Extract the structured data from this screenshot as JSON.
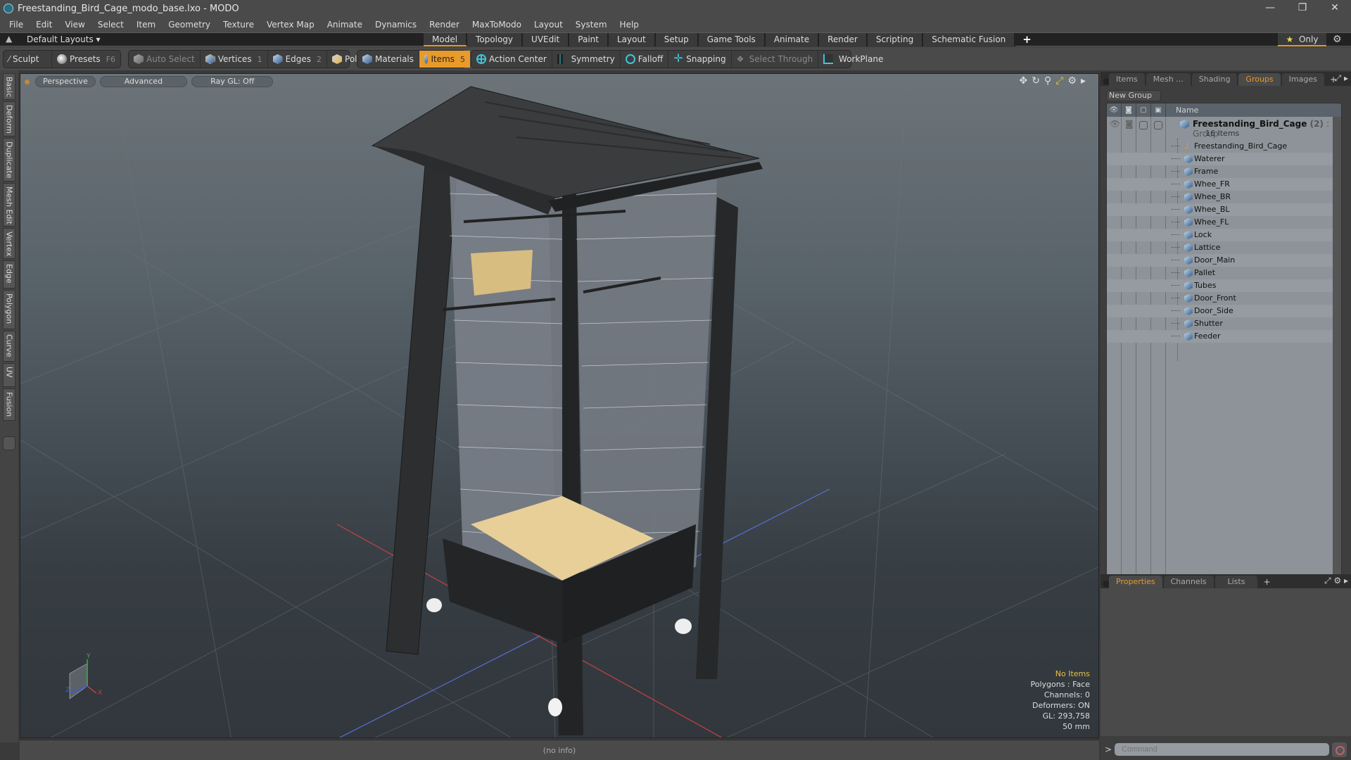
{
  "window": {
    "title": "Freestanding_Bird_Cage_modo_base.lxo - MODO",
    "controls": [
      "—",
      "❐",
      "✕"
    ]
  },
  "menu": [
    "File",
    "Edit",
    "View",
    "Select",
    "Item",
    "Geometry",
    "Texture",
    "Vertex Map",
    "Animate",
    "Dynamics",
    "Render",
    "MaxToModo",
    "Layout",
    "System",
    "Help"
  ],
  "layoutbar": {
    "layouts_label": "Default Layouts ▾",
    "tabs": [
      "Model",
      "Topology",
      "UVEdit",
      "Paint",
      "Layout",
      "Setup",
      "Game Tools",
      "Animate",
      "Render",
      "Scripting",
      "Schematic Fusion"
    ],
    "active_tab": "Model",
    "add": "+",
    "only_label": "Only",
    "accent": "#e59a2a"
  },
  "toolbar": {
    "sculpt": "Sculpt",
    "presets": "Presets",
    "presets_key": "F6",
    "auto_select": "Auto Select",
    "vertices": "Vertices",
    "vertices_key": "1",
    "edges": "Edges",
    "edges_key": "2",
    "polygons": "Polygons",
    "materials": "Materials",
    "items": "Items",
    "items_key": "5",
    "action_center": "Action Center",
    "symmetry": "Symmetry",
    "falloff": "Falloff",
    "snapping": "Snapping",
    "select_through": "Select Through",
    "workplane": "WorkPlane"
  },
  "left_tabs": [
    "Basic",
    "Deform",
    "Duplicate",
    "Mesh Edit",
    "Vertex",
    "Edge",
    "Polygon",
    "Curve",
    "UV",
    "Fusion"
  ],
  "viewport": {
    "view": "Perspective",
    "shading": "Advanced",
    "raygl": "Ray GL: Off",
    "info": {
      "selection": "No Items",
      "polygons": "Polygons : Face",
      "channels": "Channels: 0",
      "deformers": "Deformers: ON",
      "gl": "GL: 293,758",
      "scale": "50 mm"
    },
    "axis_labels": {
      "x": "X",
      "y": "Y",
      "z": "Z"
    }
  },
  "status": {
    "info": "(no info)"
  },
  "right_panel": {
    "tabs": [
      "Items",
      "Mesh ...",
      "Shading",
      "Groups",
      "Images"
    ],
    "active_tab": "Groups",
    "new_group": "New Group",
    "column_name": "Name",
    "group": {
      "name": "Freestanding_Bird_Cage",
      "count": "(2)",
      "type": ": Group",
      "items_label": "16 Items"
    },
    "members": [
      "Freestanding_Bird_Cage",
      "Waterer",
      "Frame",
      "Whee_FR",
      "Whee_BR",
      "Whee_BL",
      "Whee_FL",
      "Lock",
      "Lattice",
      "Door_Main",
      "Pallet",
      "Tubes",
      "Door_Front",
      "Door_Side",
      "Shutter",
      "Feeder"
    ],
    "bottom_tabs": [
      "Properties",
      "Channels",
      "Lists"
    ],
    "bottom_active": "Properties"
  },
  "command": {
    "placeholder": "Command"
  }
}
